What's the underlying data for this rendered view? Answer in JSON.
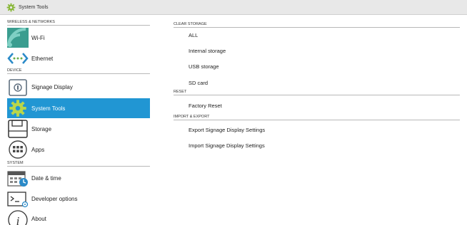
{
  "titlebar": {
    "title": "System Tools",
    "icon": "gear-icon"
  },
  "sidebar": {
    "sections": [
      {
        "label": "WIRELESS & NETWORKS"
      },
      {
        "label": "DEVICE"
      },
      {
        "label": "SYSTEM"
      }
    ],
    "items": [
      {
        "label": "Wi-Fi",
        "icon": "wifi-icon"
      },
      {
        "label": "Ethernet",
        "icon": "ethernet-icon"
      },
      {
        "label": "Signage Display",
        "icon": "signage-display-icon"
      },
      {
        "label": "System Tools",
        "icon": "gear-icon",
        "active": true
      },
      {
        "label": "Storage",
        "icon": "storage-icon"
      },
      {
        "label": "Apps",
        "icon": "apps-icon"
      },
      {
        "label": "Date & time",
        "icon": "calendar-clock-icon"
      },
      {
        "label": "Developer options",
        "icon": "terminal-icon"
      },
      {
        "label": "About",
        "icon": "info-icon"
      }
    ]
  },
  "main": {
    "sections": [
      {
        "label": "CLEAR STORAGE"
      },
      {
        "label": "RESET"
      },
      {
        "label": "IMPORT & EXPORT"
      }
    ],
    "items": [
      {
        "label": "ALL"
      },
      {
        "label": "Internal storage"
      },
      {
        "label": "USB storage"
      },
      {
        "label": "SD card"
      },
      {
        "label": "Factory Reset"
      },
      {
        "label": "Export Signage Display Settings"
      },
      {
        "label": "Import Signage Display Settings"
      }
    ]
  },
  "colors": {
    "accent": "#2196d3",
    "titlebar_bg": "#e8e8e8",
    "divider": "#b8b8b8"
  }
}
